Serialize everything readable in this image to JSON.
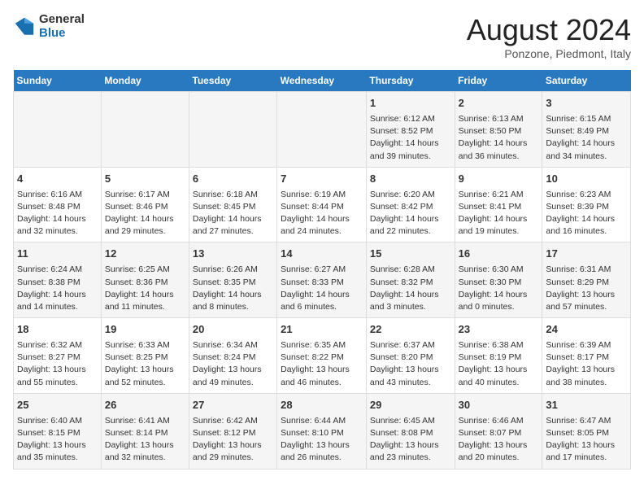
{
  "header": {
    "logo_general": "General",
    "logo_blue": "Blue",
    "title": "August 2024",
    "subtitle": "Ponzone, Piedmont, Italy"
  },
  "days": [
    "Sunday",
    "Monday",
    "Tuesday",
    "Wednesday",
    "Thursday",
    "Friday",
    "Saturday"
  ],
  "weeks": [
    [
      {
        "date": "",
        "text": ""
      },
      {
        "date": "",
        "text": ""
      },
      {
        "date": "",
        "text": ""
      },
      {
        "date": "",
        "text": ""
      },
      {
        "date": "1",
        "text": "Sunrise: 6:12 AM\nSunset: 8:52 PM\nDaylight: 14 hours and 39 minutes."
      },
      {
        "date": "2",
        "text": "Sunrise: 6:13 AM\nSunset: 8:50 PM\nDaylight: 14 hours and 36 minutes."
      },
      {
        "date": "3",
        "text": "Sunrise: 6:15 AM\nSunset: 8:49 PM\nDaylight: 14 hours and 34 minutes."
      }
    ],
    [
      {
        "date": "4",
        "text": "Sunrise: 6:16 AM\nSunset: 8:48 PM\nDaylight: 14 hours and 32 minutes."
      },
      {
        "date": "5",
        "text": "Sunrise: 6:17 AM\nSunset: 8:46 PM\nDaylight: 14 hours and 29 minutes."
      },
      {
        "date": "6",
        "text": "Sunrise: 6:18 AM\nSunset: 8:45 PM\nDaylight: 14 hours and 27 minutes."
      },
      {
        "date": "7",
        "text": "Sunrise: 6:19 AM\nSunset: 8:44 PM\nDaylight: 14 hours and 24 minutes."
      },
      {
        "date": "8",
        "text": "Sunrise: 6:20 AM\nSunset: 8:42 PM\nDaylight: 14 hours and 22 minutes."
      },
      {
        "date": "9",
        "text": "Sunrise: 6:21 AM\nSunset: 8:41 PM\nDaylight: 14 hours and 19 minutes."
      },
      {
        "date": "10",
        "text": "Sunrise: 6:23 AM\nSunset: 8:39 PM\nDaylight: 14 hours and 16 minutes."
      }
    ],
    [
      {
        "date": "11",
        "text": "Sunrise: 6:24 AM\nSunset: 8:38 PM\nDaylight: 14 hours and 14 minutes."
      },
      {
        "date": "12",
        "text": "Sunrise: 6:25 AM\nSunset: 8:36 PM\nDaylight: 14 hours and 11 minutes."
      },
      {
        "date": "13",
        "text": "Sunrise: 6:26 AM\nSunset: 8:35 PM\nDaylight: 14 hours and 8 minutes."
      },
      {
        "date": "14",
        "text": "Sunrise: 6:27 AM\nSunset: 8:33 PM\nDaylight: 14 hours and 6 minutes."
      },
      {
        "date": "15",
        "text": "Sunrise: 6:28 AM\nSunset: 8:32 PM\nDaylight: 14 hours and 3 minutes."
      },
      {
        "date": "16",
        "text": "Sunrise: 6:30 AM\nSunset: 8:30 PM\nDaylight: 14 hours and 0 minutes."
      },
      {
        "date": "17",
        "text": "Sunrise: 6:31 AM\nSunset: 8:29 PM\nDaylight: 13 hours and 57 minutes."
      }
    ],
    [
      {
        "date": "18",
        "text": "Sunrise: 6:32 AM\nSunset: 8:27 PM\nDaylight: 13 hours and 55 minutes."
      },
      {
        "date": "19",
        "text": "Sunrise: 6:33 AM\nSunset: 8:25 PM\nDaylight: 13 hours and 52 minutes."
      },
      {
        "date": "20",
        "text": "Sunrise: 6:34 AM\nSunset: 8:24 PM\nDaylight: 13 hours and 49 minutes."
      },
      {
        "date": "21",
        "text": "Sunrise: 6:35 AM\nSunset: 8:22 PM\nDaylight: 13 hours and 46 minutes."
      },
      {
        "date": "22",
        "text": "Sunrise: 6:37 AM\nSunset: 8:20 PM\nDaylight: 13 hours and 43 minutes."
      },
      {
        "date": "23",
        "text": "Sunrise: 6:38 AM\nSunset: 8:19 PM\nDaylight: 13 hours and 40 minutes."
      },
      {
        "date": "24",
        "text": "Sunrise: 6:39 AM\nSunset: 8:17 PM\nDaylight: 13 hours and 38 minutes."
      }
    ],
    [
      {
        "date": "25",
        "text": "Sunrise: 6:40 AM\nSunset: 8:15 PM\nDaylight: 13 hours and 35 minutes."
      },
      {
        "date": "26",
        "text": "Sunrise: 6:41 AM\nSunset: 8:14 PM\nDaylight: 13 hours and 32 minutes."
      },
      {
        "date": "27",
        "text": "Sunrise: 6:42 AM\nSunset: 8:12 PM\nDaylight: 13 hours and 29 minutes."
      },
      {
        "date": "28",
        "text": "Sunrise: 6:44 AM\nSunset: 8:10 PM\nDaylight: 13 hours and 26 minutes."
      },
      {
        "date": "29",
        "text": "Sunrise: 6:45 AM\nSunset: 8:08 PM\nDaylight: 13 hours and 23 minutes."
      },
      {
        "date": "30",
        "text": "Sunrise: 6:46 AM\nSunset: 8:07 PM\nDaylight: 13 hours and 20 minutes."
      },
      {
        "date": "31",
        "text": "Sunrise: 6:47 AM\nSunset: 8:05 PM\nDaylight: 13 hours and 17 minutes."
      }
    ]
  ]
}
